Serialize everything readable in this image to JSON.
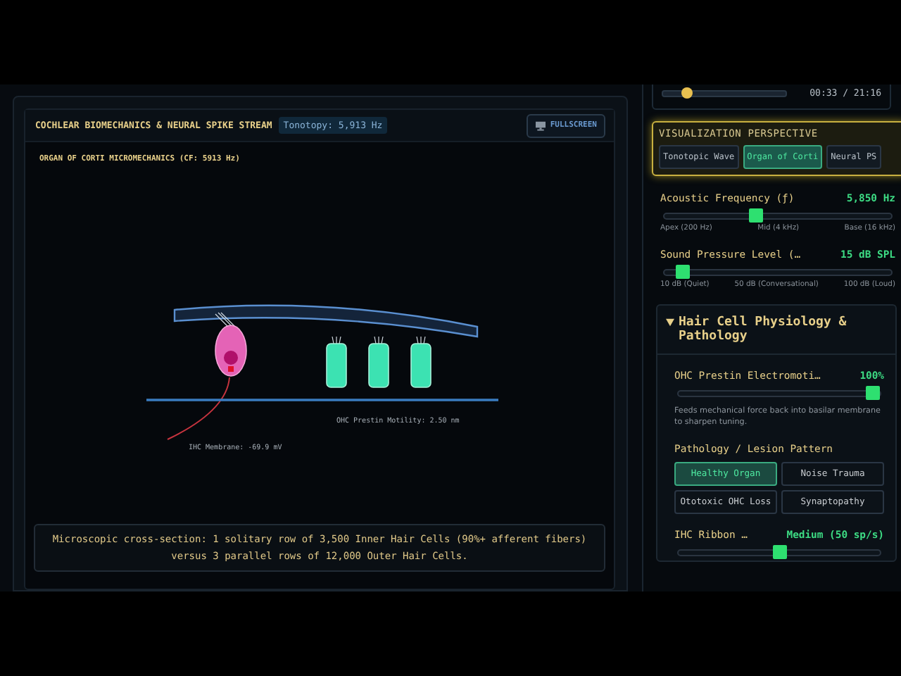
{
  "stream_panel": {
    "title": "COCHLEAR BIOMECHANICS & NEURAL SPIKE STREAM",
    "badge": "Tonotopy: 5,913 Hz",
    "fullscreen_button": "FULLSCREEN",
    "subtitle": "ORGAN OF CORTI MICROMECHANICS (CF: 5913 Hz)",
    "diagram": {
      "ohc_label": "OHC Prestin Motility: 2.50 nm",
      "ihc_label": "IHC Membrane: -69.9 mV"
    },
    "caption": "Microscopic cross-section: 1 solitary row of 3,500 Inner Hair Cells (90%+ afferent fibers) versus 3 parallel rows of 12,000 Outer Hair Cells."
  },
  "playback": {
    "level": 0.2,
    "time": "00:33 / 21:16"
  },
  "perspective": {
    "title": "VISUALIZATION PERSPECTIVE",
    "tabs": [
      {
        "label": "Tonotopic Wave",
        "selected": false
      },
      {
        "label": "Organ of Corti",
        "selected": true
      },
      {
        "label": "Neural PS",
        "selected": false
      }
    ]
  },
  "sliders": [
    {
      "label": "Acoustic Frequency (ƒ)",
      "value": "5,850 Hz",
      "level": 0.4,
      "ticks": [
        "Apex (200 Hz)",
        "Mid (4 kHz)",
        "Base (16 kHz)"
      ]
    },
    {
      "label": "Sound Pressure Level (…",
      "value": "15 dB SPL",
      "level": 0.05,
      "ticks": [
        "10 dB (Quiet)",
        "50 dB (Conversational)",
        "100 dB (Loud)"
      ]
    }
  ],
  "hair_cell": {
    "title": "Hair Cell Physiology & Pathology",
    "expanded": true,
    "prestin": {
      "label": "OHC Prestin Electromoti…",
      "value": "100%",
      "level": 1,
      "description": "Feeds mechanical force back into basilar membrane to sharpen tuning."
    },
    "pathology": {
      "label": "Pathology / Lesion Pattern",
      "options": [
        {
          "label": "Healthy Organ",
          "selected": true
        },
        {
          "label": "Noise Trauma",
          "selected": false
        },
        {
          "label": "Ototoxic OHC Loss",
          "selected": false
        },
        {
          "label": "Synaptopathy",
          "selected": false
        }
      ]
    },
    "ribbon": {
      "label": "IHC Ribbon …",
      "value": "Medium (50 sp/s)",
      "level": 0.5
    }
  }
}
